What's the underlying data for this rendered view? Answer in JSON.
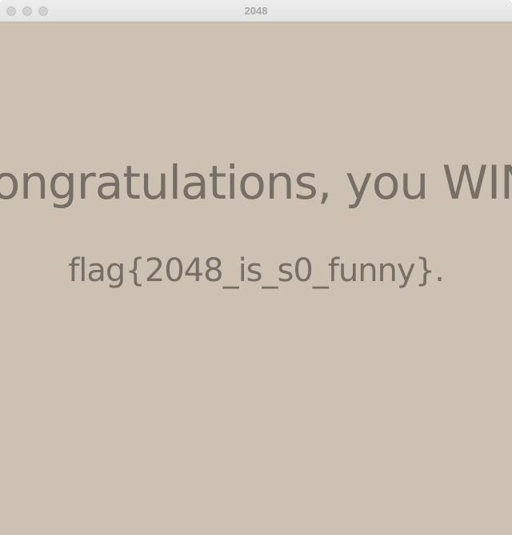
{
  "window": {
    "title": "2048"
  },
  "message": {
    "headline": "Congratulations, you WIN!",
    "flag": "flag{2048_is_s0_funny}."
  },
  "colors": {
    "background": "#cdc1b4",
    "text": "#776e65"
  }
}
